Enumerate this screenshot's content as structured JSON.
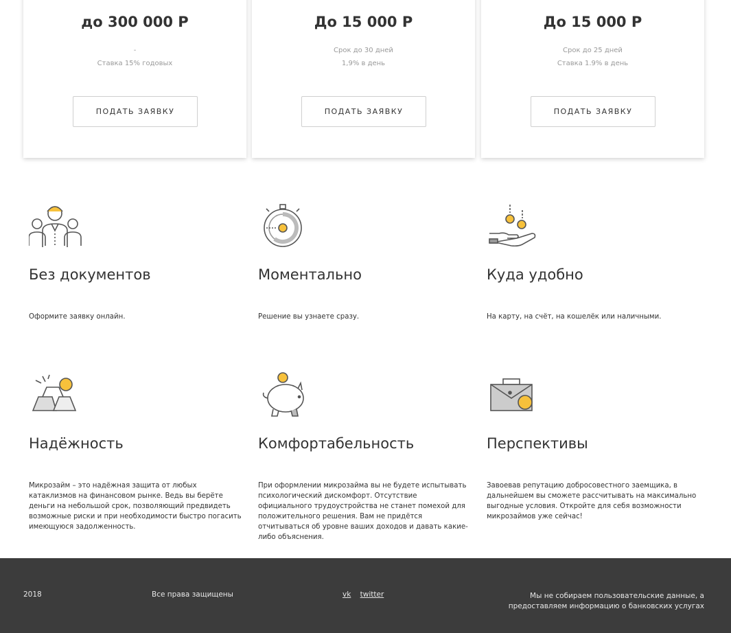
{
  "cards": [
    {
      "amount": "до 300 000 Р",
      "line1": "-",
      "line2": "Ставка 15% годовых",
      "button": "ПОДАТЬ ЗАЯВКУ"
    },
    {
      "amount": "До 15 000 Р",
      "line1": "Срок до 30 дней",
      "line2": "1,9% в день",
      "button": "ПОДАТЬ ЗАЯВКУ"
    },
    {
      "amount": "До 15 000 Р",
      "line1": "Срок до 25 дней",
      "line2": "Ставка 1.9% в день",
      "button": "ПОДАТЬ ЗАЯВКУ"
    }
  ],
  "features": [
    {
      "icon": "people-icon",
      "title": "Без документов",
      "desc": "Оформите заявку онлайн."
    },
    {
      "icon": "stopwatch-icon",
      "title": "Моментально",
      "desc": "Решение вы узнаете сразу."
    },
    {
      "icon": "hand-coins-icon",
      "title": "Куда удобно",
      "desc": "На карту, на счёт, на кошелёк или наличными."
    },
    {
      "icon": "gold-bars-icon",
      "title": "Надёжность",
      "desc": "Микрозайм – это надёжная защита от любых катаклизмов на финансовом рынке. Ведь вы берёте деньги на небольшой срок, позволяющий предвидеть возможные риски и при необходимости быстро погасить имеющуюся задолженность."
    },
    {
      "icon": "piggy-bank-icon",
      "title": "Комфортабельность",
      "desc": "При оформлении микрозайма вы не будете испытывать психологический дискомфорт. Отсутствие официального трудоустройства не станет помехой для положительного решения. Вам не придётся отчитываться об  уровне ваших доходов и давать какие-либо объяснения."
    },
    {
      "icon": "briefcase-icon",
      "title": "Перспективы",
      "desc": "Завоевав репутацию добросовестного заемщика, в дальнейшем вы сможете рассчитывать на максимально выгодные условия. Откройте для себя возможности микрозаймов уже сейчас!"
    }
  ],
  "footer": {
    "year": "2018",
    "rights": "Все права защищены",
    "link_vk": "vk",
    "link_twitter": "twitter",
    "note": "Мы не собираем пользовательские данные, а предоставляем информацию о банковских услугах"
  },
  "colors": {
    "accent": "#f7c13b",
    "footer_bg": "#3c3c3c"
  }
}
